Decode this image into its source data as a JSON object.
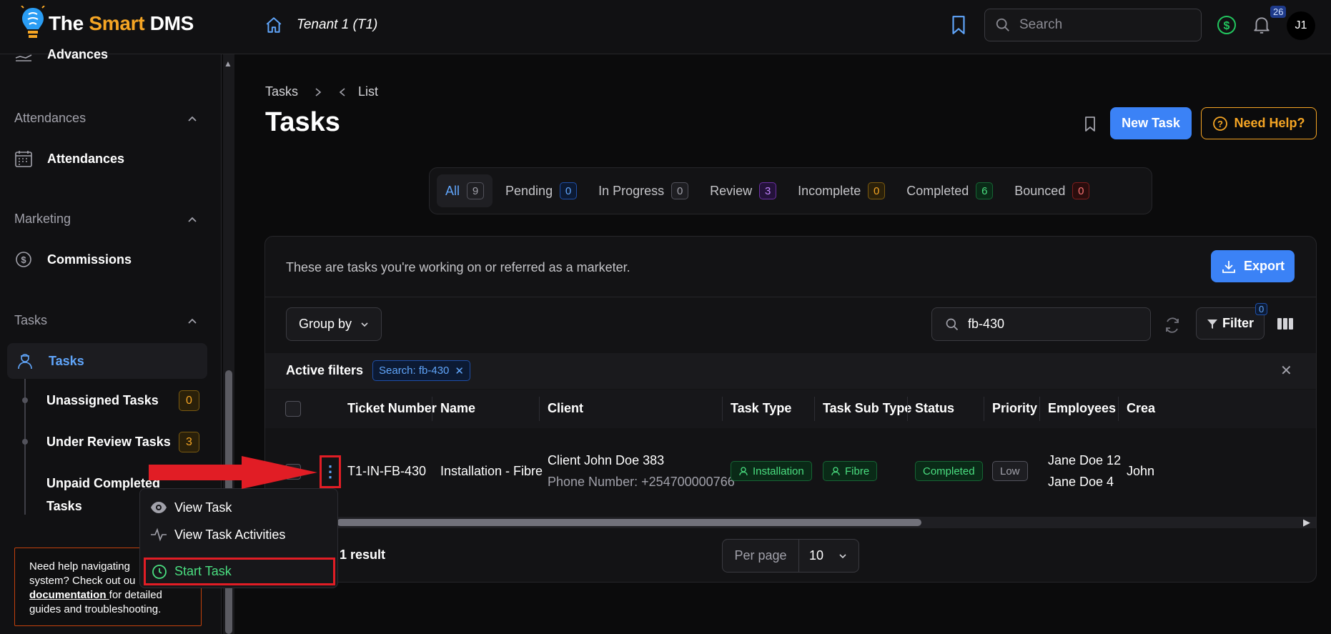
{
  "topbar": {
    "logo_prefix": "The ",
    "logo_accent": "Smart",
    "logo_suffix": " DMS",
    "tenant": "Tenant 1 (T1)",
    "search_placeholder": "Search",
    "notifications_count": "26",
    "avatar_initials": "J1"
  },
  "sidebar": {
    "prev_item": "Advances",
    "sections": [
      {
        "title": "Attendances",
        "item": "Attendances"
      },
      {
        "title": "Marketing",
        "item": "Commissions"
      },
      {
        "title": "Tasks",
        "item": "Tasks"
      }
    ],
    "sub_items": [
      {
        "label": "Unassigned Tasks",
        "count": "0"
      },
      {
        "label": "Under Review Tasks",
        "count": "3"
      },
      {
        "label": "Unpaid Completed Tasks",
        "count": ""
      }
    ],
    "help": {
      "line1": "Need help navigating",
      "line2": "system? Check out ou",
      "link": "documentation ",
      "line3": "for detailed",
      "line4": "guides and troubleshooting."
    }
  },
  "breadcrumb": {
    "root": "Tasks",
    "current": "List"
  },
  "page": {
    "title": "Tasks",
    "new_task": "New Task",
    "need_help": "Need Help?"
  },
  "tabs": [
    {
      "label": "All",
      "count": "9"
    },
    {
      "label": "Pending",
      "count": "0"
    },
    {
      "label": "In Progress",
      "count": "0"
    },
    {
      "label": "Review",
      "count": "3"
    },
    {
      "label": "Incomplete",
      "count": "0"
    },
    {
      "label": "Completed",
      "count": "6"
    },
    {
      "label": "Bounced",
      "count": "0"
    }
  ],
  "panel": {
    "description": "These are tasks you're working on or referred as a marketer.",
    "export": "Export",
    "group_by": "Group by",
    "search_value": "fb-430",
    "filter": "Filter",
    "filter_count": "0",
    "active_filters_label": "Active filters",
    "active_filter_chip": "Search: fb-430"
  },
  "table": {
    "columns": [
      "Ticket Number",
      "Name",
      "Client",
      "Task Type",
      "Task Sub Type",
      "Status",
      "Priority",
      "Employees",
      "Crea"
    ],
    "row": {
      "ticket": "T1-IN-FB-430",
      "name": "Installation - Fibre",
      "client_name": "Client John Doe 383",
      "client_phone": "Phone Number: +254700000766",
      "task_type": "Installation",
      "task_sub_type": "Fibre",
      "status": "Completed",
      "priority": "Low",
      "employee1": "Jane Doe 12",
      "employee2": "Jane Doe 4",
      "creator": "John"
    }
  },
  "footer": {
    "result": "1 result",
    "per_page_label": "Per page",
    "per_page_value": "10"
  },
  "menu": {
    "items": [
      "View Task",
      "View Task Activities",
      "Start Task"
    ]
  },
  "colors": {
    "accent_blue": "#3b82f6",
    "accent_orange": "#f5a524",
    "success_green": "#4ade80",
    "highlight_red": "#e11d25"
  }
}
